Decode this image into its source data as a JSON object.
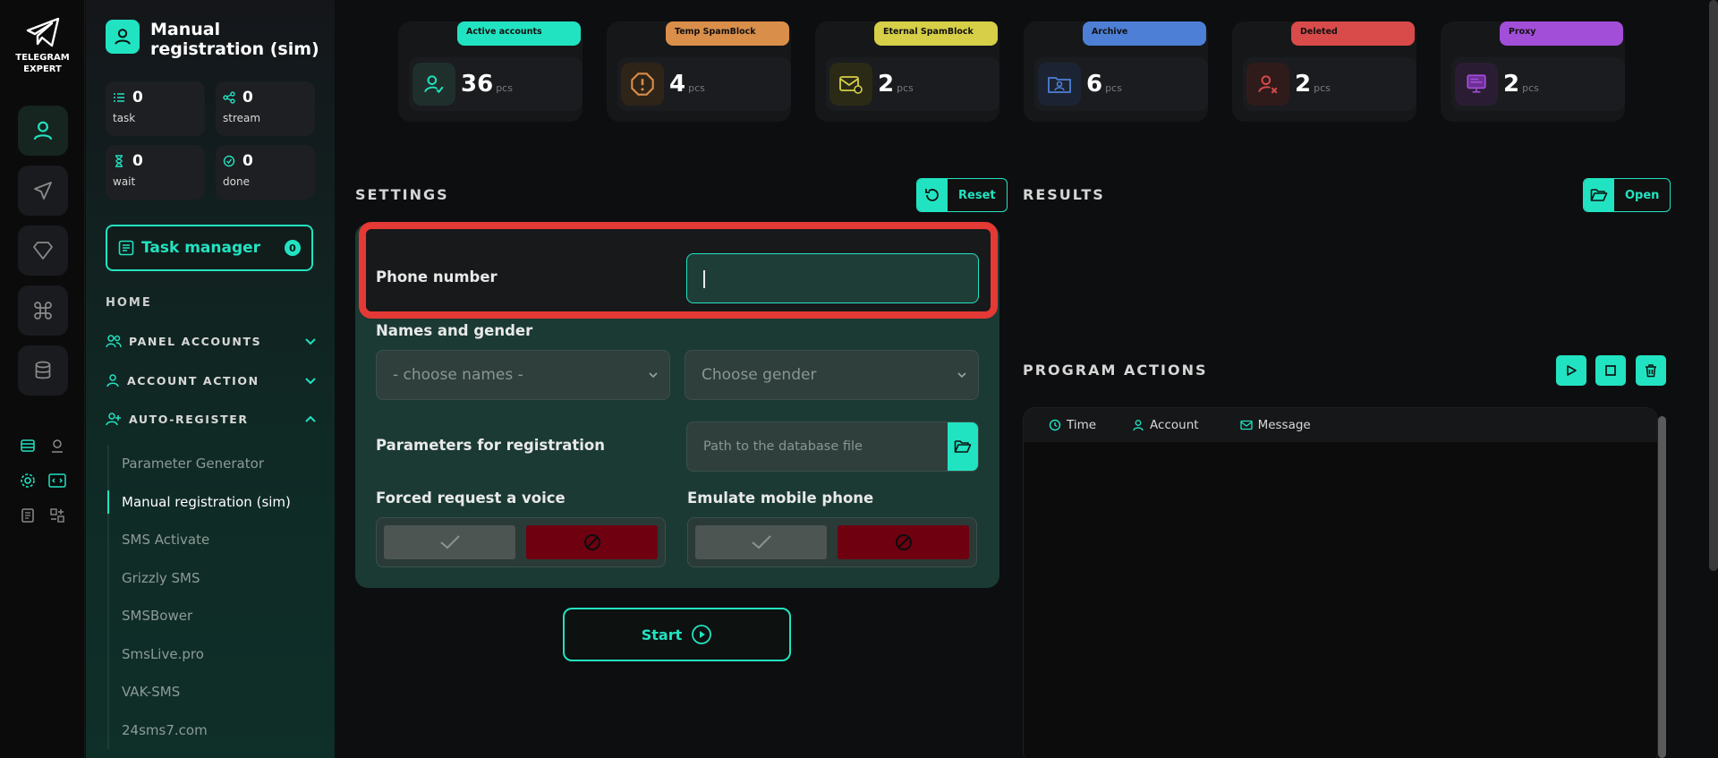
{
  "app": {
    "logo_line1": "TELEGRAM",
    "logo_line2": "EXPERT"
  },
  "sidebar": {
    "title": "Manual registration (sim)",
    "stats": [
      {
        "value": "0",
        "label": "task"
      },
      {
        "value": "0",
        "label": "stream"
      },
      {
        "value": "0",
        "label": "wait"
      },
      {
        "value": "0",
        "label": "done"
      }
    ],
    "task_manager": {
      "label": "Task manager",
      "count": "0"
    },
    "home_label": "HOME",
    "groups": [
      {
        "label": "PANEL ACCOUNTS"
      },
      {
        "label": "ACCOUNT ACTION"
      },
      {
        "label": "AUTO-REGISTER"
      }
    ],
    "subitems": [
      "Parameter Generator",
      "Manual registration (sim)",
      "SMS Activate",
      "Grizzly SMS",
      "SMSBower",
      "SmsLive.pro",
      "VAK-SMS",
      "24sms7.com"
    ]
  },
  "cards": [
    {
      "badge": "Active accounts",
      "value": "36",
      "unit": "pcs",
      "color": "#22e3c1",
      "icon": "user-check-icon"
    },
    {
      "badge": "Temp SpamBlock",
      "value": "4",
      "unit": "pcs",
      "color": "#d98e4a",
      "icon": "alert-octagon-icon"
    },
    {
      "badge": "Eternal SpamBlock",
      "value": "2",
      "unit": "pcs",
      "color": "#d6cf47",
      "icon": "mail-block-icon"
    },
    {
      "badge": "Archive",
      "value": "6",
      "unit": "pcs",
      "color": "#4d7fd6",
      "icon": "folder-user-icon"
    },
    {
      "badge": "Deleted",
      "value": "2",
      "unit": "pcs",
      "color": "#d94a4a",
      "icon": "user-x-icon"
    },
    {
      "badge": "Proxy",
      "value": "2",
      "unit": "pcs",
      "color": "#a24ed8",
      "icon": "monitor-icon"
    }
  ],
  "settings": {
    "title": "SETTINGS",
    "reset_label": "Reset",
    "phone_label": "Phone number",
    "phone_value": "",
    "names_label": "Names and gender",
    "names_placeholder": "- choose names -",
    "gender_placeholder": "Choose gender",
    "params_label": "Parameters for registration",
    "path_placeholder": "Path to the database file",
    "voice_label": "Forced request a voice",
    "mobile_label": "Emulate mobile phone",
    "start_label": "Start"
  },
  "results": {
    "title": "RESULTS",
    "open_label": "Open"
  },
  "program_actions": {
    "title": "PROGRAM ACTIONS",
    "columns": [
      "Time",
      "Account",
      "Message"
    ]
  },
  "colors": {
    "accent": "#22e3c1",
    "highlight": "#e53935",
    "deny": "#6e0010"
  }
}
